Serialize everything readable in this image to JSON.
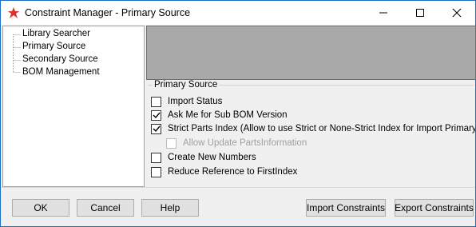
{
  "window": {
    "title": "Constraint Manager - Primary Source",
    "accent": "#d9342b"
  },
  "tree": {
    "items": [
      {
        "label": "Library Searcher"
      },
      {
        "label": "Primary Source"
      },
      {
        "label": "Secondary Source"
      },
      {
        "label": "BOM Management"
      }
    ]
  },
  "group": {
    "label": "Primary Source",
    "options": [
      {
        "label": "Import Status",
        "checked": false,
        "disabled": false
      },
      {
        "label": "Ask Me for Sub BOM Version",
        "checked": true,
        "disabled": false
      },
      {
        "label": "Strict Parts Index  (Allow to use Strict or None-Strict Index for Import Primary Source)",
        "checked": true,
        "disabled": false
      },
      {
        "label": "Allow Update PartsInformation",
        "checked": false,
        "disabled": true
      },
      {
        "label": "Create New Numbers",
        "checked": false,
        "disabled": false
      },
      {
        "label": "Reduce Reference to FirstIndex",
        "checked": false,
        "disabled": false
      }
    ]
  },
  "buttons": {
    "ok": "OK",
    "cancel": "Cancel",
    "help": "Help",
    "import_constraints": "Import Constraints",
    "export_constraints": "Export Constraints"
  }
}
